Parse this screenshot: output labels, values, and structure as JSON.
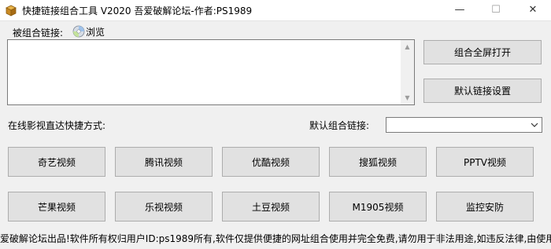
{
  "window": {
    "title": "快捷链接组合工具 V2020  吾爱破解论坛-作者:PS1989",
    "minimize_glyph": "—",
    "maximize_glyph": "☐",
    "close_glyph": "✕"
  },
  "input": {
    "label": "被组合链接:",
    "browse_label": "浏览",
    "browse_icon": "cd-disc-icon",
    "value": ""
  },
  "actions": {
    "open_fullscreen": "组合全屏打开",
    "default_link_settings": "默认链接设置"
  },
  "quick": {
    "label": "在线影视直达快捷方式:",
    "default_label": "默认组合链接:",
    "default_value": ""
  },
  "buttons": {
    "row1": [
      "奇艺视频",
      "腾讯视频",
      "优酷视频",
      "搜狐视频",
      "PPTV视频"
    ],
    "row2": [
      "芒果视频",
      "乐视视频",
      "土豆视频",
      "M1905视频",
      "监控安防"
    ]
  },
  "footer": {
    "text": "爱破解论坛出品!软件所有权归用户ID:ps1989所有,软件仅提供便捷的网址组合使用并完全免费,请勿用于非法用途,如违反法律,由使用"
  }
}
